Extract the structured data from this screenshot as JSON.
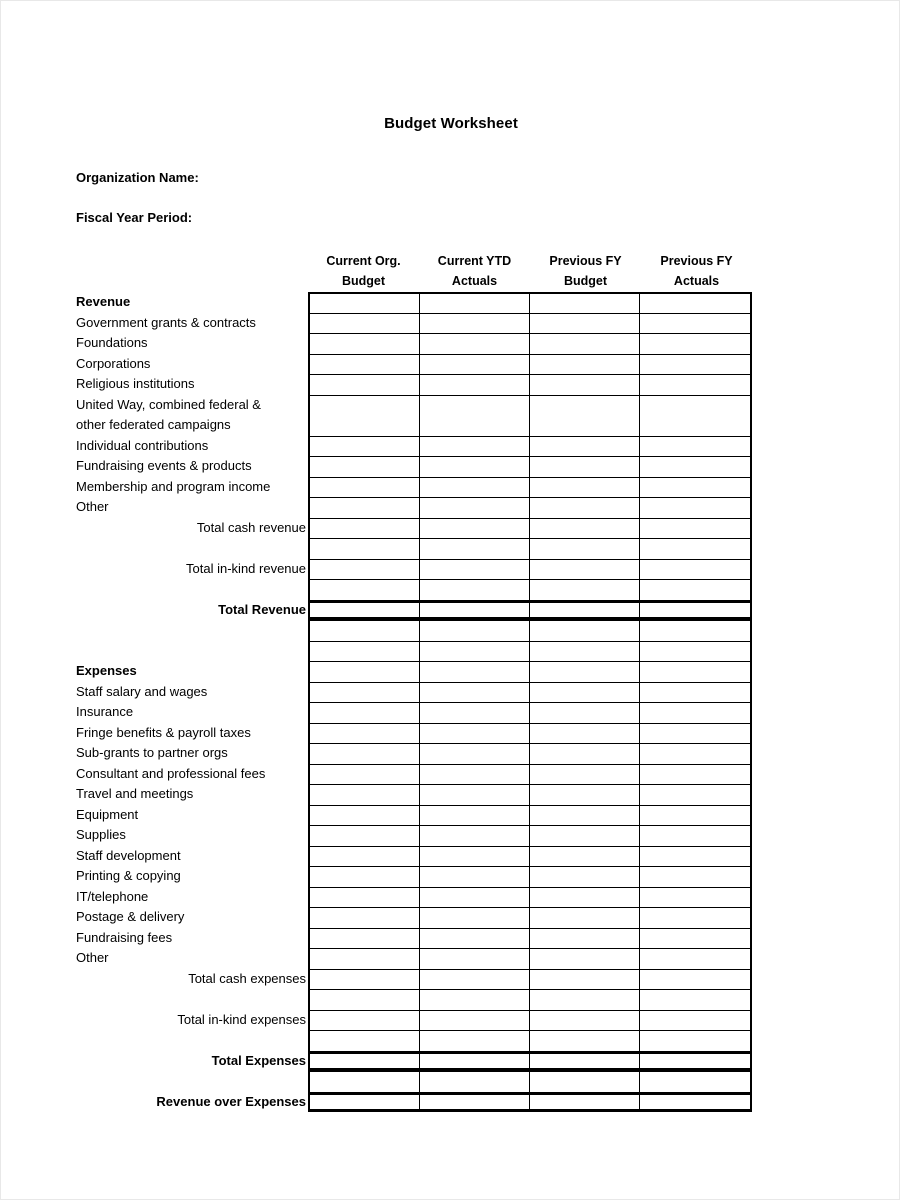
{
  "document": {
    "title": "Budget Worksheet"
  },
  "form_fields": [
    {
      "label": "Organization Name:"
    },
    {
      "label": "Fiscal Year Period:"
    }
  ],
  "column_headers": [
    {
      "line1": "Current Org.",
      "line2": "Budget"
    },
    {
      "line1": "Current YTD",
      "line2": "Actuals"
    },
    {
      "line1": "Previous FY",
      "line2": "Budget"
    },
    {
      "line1": "Previous FY",
      "line2": "Actuals"
    }
  ],
  "rows": [
    {
      "label": "Revenue",
      "type": "section"
    },
    {
      "label": "Government grants & contracts",
      "type": "item"
    },
    {
      "label": "Foundations",
      "type": "item"
    },
    {
      "label": "Corporations",
      "type": "item"
    },
    {
      "label": "Religious institutions",
      "type": "item"
    },
    {
      "label": "United Way, combined federal &\nother federated campaigns",
      "type": "item",
      "tall": true
    },
    {
      "label": "Individual contributions",
      "type": "item"
    },
    {
      "label": "Fundraising events & products",
      "type": "item"
    },
    {
      "label": "Membership and program income",
      "type": "item"
    },
    {
      "label": "Other",
      "type": "item"
    },
    {
      "label": "Total cash revenue",
      "type": "subtotal"
    },
    {
      "label": "",
      "type": "blank"
    },
    {
      "label": "Total in-kind revenue",
      "type": "subtotal"
    },
    {
      "label": "",
      "type": "blank"
    },
    {
      "label": "Total Revenue",
      "type": "grand"
    },
    {
      "label": "",
      "type": "blank"
    },
    {
      "label": "",
      "type": "blank"
    },
    {
      "label": "Expenses",
      "type": "section"
    },
    {
      "label": "Staff salary and wages",
      "type": "item"
    },
    {
      "label": "Insurance",
      "type": "item"
    },
    {
      "label": "Fringe benefits & payroll taxes",
      "type": "item"
    },
    {
      "label": "Sub-grants to partner orgs",
      "type": "item"
    },
    {
      "label": "Consultant and professional fees",
      "type": "item"
    },
    {
      "label": "Travel and meetings",
      "type": "item"
    },
    {
      "label": "Equipment",
      "type": "item"
    },
    {
      "label": "Supplies",
      "type": "item"
    },
    {
      "label": "Staff development",
      "type": "item"
    },
    {
      "label": "Printing & copying",
      "type": "item"
    },
    {
      "label": "IT/telephone",
      "type": "item"
    },
    {
      "label": "Postage & delivery",
      "type": "item"
    },
    {
      "label": "Fundraising fees",
      "type": "item"
    },
    {
      "label": "Other",
      "type": "item"
    },
    {
      "label": "Total cash expenses",
      "type": "subtotal"
    },
    {
      "label": "",
      "type": "blank"
    },
    {
      "label": "Total in-kind expenses",
      "type": "subtotal"
    },
    {
      "label": "",
      "type": "blank"
    },
    {
      "label": "Total Expenses",
      "type": "grand"
    },
    {
      "label": "",
      "type": "blank"
    },
    {
      "label": "Revenue over Expenses",
      "type": "grand"
    }
  ]
}
